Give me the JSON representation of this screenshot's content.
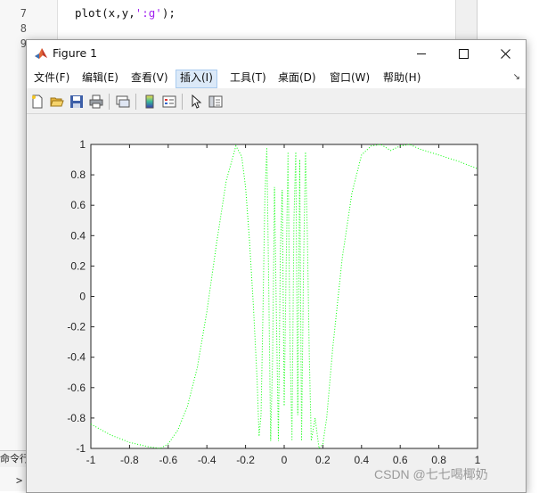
{
  "editor": {
    "line_numbers": [
      "7",
      "8",
      "9"
    ],
    "code_prefix": "plot(x,y,",
    "code_string": "':g'",
    "code_suffix": ");",
    "command_window_label": "命令行",
    "prompt": ">"
  },
  "figure": {
    "title": "Figure 1",
    "menu": [
      {
        "label": "文件(F)"
      },
      {
        "label": "编辑(E)"
      },
      {
        "label": "查看(V)"
      },
      {
        "label": "插入(I)"
      },
      {
        "label": "工具(T)"
      },
      {
        "label": "桌面(D)"
      },
      {
        "label": "窗口(W)"
      },
      {
        "label": "帮助(H)"
      }
    ],
    "active_menu": "插入(I)",
    "toolbar_icons": [
      "new-figure-icon",
      "open-file-icon",
      "save-icon",
      "print-icon",
      "link-plot-icon",
      "colorbar-icon",
      "legend-icon",
      "pointer-icon",
      "property-editor-icon"
    ]
  },
  "chart_data": {
    "type": "line",
    "line_style": "dotted",
    "color": "#00ff00",
    "xlim": [
      -1,
      1
    ],
    "ylim": [
      -1,
      1
    ],
    "xticks": [
      "-1",
      "-0.8",
      "-0.6",
      "-0.4",
      "-0.2",
      "0",
      "0.2",
      "0.4",
      "0.6",
      "0.8",
      "1"
    ],
    "yticks": [
      "1",
      "0.8",
      "0.6",
      "0.4",
      "0.2",
      "0",
      "-0.2",
      "-0.4",
      "-0.6",
      "-0.8",
      "-1"
    ],
    "series": [
      {
        "x": [
          -1,
          -0.9,
          -0.8,
          -0.7,
          -0.64,
          -0.6,
          -0.55,
          -0.5,
          -0.45,
          -0.4,
          -0.35,
          -0.3,
          -0.25,
          -0.22,
          -0.2,
          -0.18,
          -0.16,
          -0.14,
          -0.13,
          -0.12,
          -0.11,
          -0.1,
          -0.09,
          -0.08,
          -0.07,
          -0.06,
          -0.05,
          -0.04,
          -0.03,
          -0.02,
          -0.01,
          0,
          0.01,
          0.02,
          0.03,
          0.04,
          0.05,
          0.06,
          0.07,
          0.08,
          0.09,
          0.1,
          0.11,
          0.12,
          0.13,
          0.14,
          0.16,
          0.18,
          0.2,
          0.22,
          0.25,
          0.3,
          0.35,
          0.4,
          0.45,
          0.5,
          0.55,
          0.6,
          0.65,
          0.7,
          0.8,
          0.9,
          1
        ],
        "y": [
          -0.84,
          -0.91,
          -0.96,
          -0.99,
          -1.0,
          -0.97,
          -0.88,
          -0.72,
          -0.47,
          -0.1,
          0.35,
          0.76,
          0.99,
          0.92,
          0.72,
          0.38,
          -0.05,
          -0.55,
          -0.92,
          -0.78,
          -0.12,
          0.65,
          0.98,
          0.08,
          -0.95,
          -0.4,
          0.72,
          -0.15,
          -0.95,
          0.3,
          0.7,
          -0.72,
          0.2,
          0.95,
          -0.3,
          -0.95,
          0.5,
          0.95,
          -0.78,
          0.9,
          -0.95,
          0.2,
          0.95,
          0.4,
          -0.4,
          -0.95,
          -0.8,
          -1.0,
          -0.97,
          -0.8,
          -0.35,
          0.25,
          0.68,
          0.93,
          0.99,
          1.0,
          0.96,
          0.99,
          1.0,
          0.97,
          0.93,
          0.89,
          0.84
        ]
      }
    ]
  },
  "watermark": "CSDN @七七喝椰奶"
}
